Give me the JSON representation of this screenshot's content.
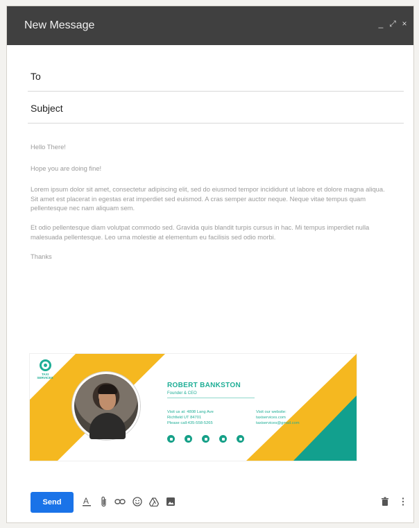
{
  "window": {
    "title": "New Message",
    "controls": {
      "minimize": "_",
      "expand": "⤢",
      "close": "×"
    }
  },
  "fields": {
    "to_label": "To",
    "to_value": "",
    "subject_label": "Subject",
    "subject_value": ""
  },
  "message": {
    "greeting": "Hello There!",
    "line1": "Hope you are doing fine!",
    "para1": "Lorem ipsum dolor sit amet, consectetur adipiscing elit, sed do eiusmod tempor incididunt ut labore et dolore magna aliqua. Sit amet est placerat in egestas erat imperdiet sed euismod. A cras semper auctor neque. Neque vitae tempus quam pellentesque nec nam aliquam sem.",
    "para2": " Et odio pellentesque diam volutpat commodo sed. Gravida quis blandit turpis cursus in hac. Mi tempus imperdiet nulla malesuada pellentesque. Leo urna molestie at elementum eu facilisis sed odio morbi.",
    "closing": "Thanks"
  },
  "signature": {
    "logo_text": "TAXI SERVICES",
    "name": "ROBERT BANKSTON",
    "role": "Founder & CEO",
    "address_line1": "Visit us at: 4808 Lang Ave",
    "address_line2": "Richfield UT 84701",
    "phone": "Please call:435-558-5265",
    "web_label": "Visit our website:",
    "web_url": "taxiservices.com",
    "email": "taxiservices@gmail.com",
    "socials": [
      "facebook-icon",
      "twitter-icon",
      "google-plus-icon",
      "pinterest-icon",
      "instagram-icon"
    ],
    "colors": {
      "accent": "#1fae96",
      "yellow": "#f5b820",
      "teal": "#12a08e"
    }
  },
  "toolbar": {
    "send_label": "Send",
    "icons": [
      "format-text-icon",
      "attach-icon",
      "link-icon",
      "emoji-icon",
      "drive-icon",
      "image-icon",
      "trash-icon",
      "more-options-icon"
    ]
  },
  "colors": {
    "titlebar": "#404040",
    "send": "#1a73e8"
  }
}
